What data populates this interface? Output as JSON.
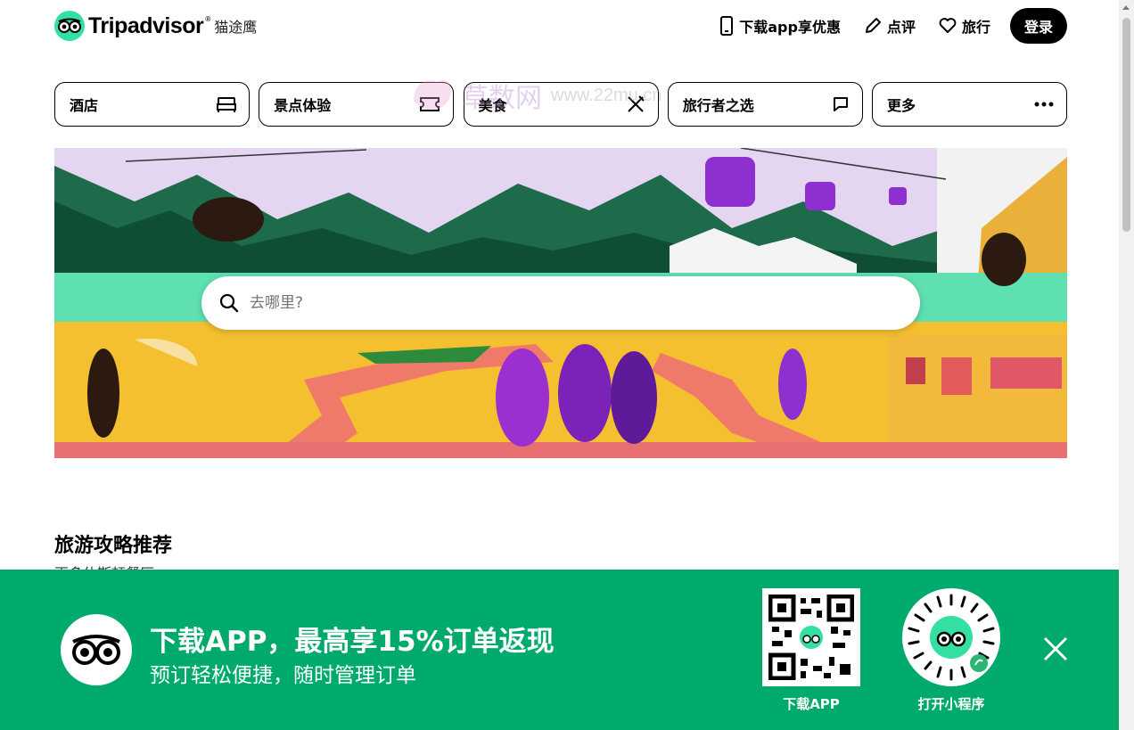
{
  "brand": {
    "name": "Tripadvisor",
    "reg": "®",
    "cn_name": "猫途鹰"
  },
  "header": {
    "download_app": "下载app享优惠",
    "review": "点评",
    "trips": "旅行",
    "login": "登录"
  },
  "tabs": [
    {
      "label": "酒店",
      "icon": "bed-icon"
    },
    {
      "label": "景点体验",
      "icon": "ticket-icon"
    },
    {
      "label": "美食",
      "icon": "fork-knife-icon"
    },
    {
      "label": "旅行者之选",
      "icon": "chat-bubble-icon"
    },
    {
      "label": "更多",
      "icon": "more-dots-icon"
    }
  ],
  "watermark": {
    "text": "草数网",
    "url": "www.22mu.cn"
  },
  "search": {
    "placeholder": "去哪里?"
  },
  "section": {
    "title": "旅游攻略推荐",
    "subtitle": "更多休斯顿餐厅"
  },
  "banner": {
    "title": "下载APP，最高享15%订单返现",
    "subtitle": "预订轻松便捷，随时管理订单",
    "qr_label": "下载APP",
    "mini_label": "打开小程序"
  },
  "colors": {
    "brand_green": "#34e0a1",
    "banner_green": "#00aa6c"
  }
}
